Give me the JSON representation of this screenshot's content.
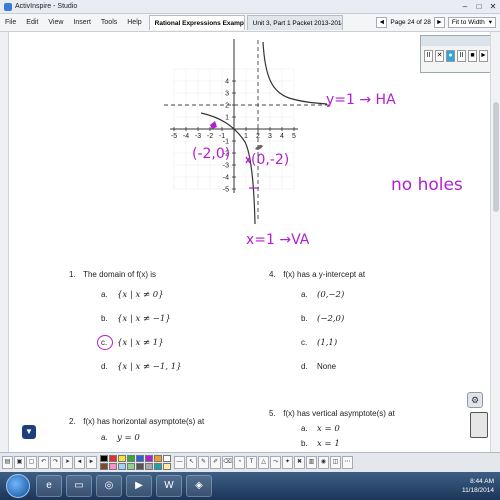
{
  "window": {
    "title": "ActivInspire - Studio",
    "controls": [
      "–",
      "□",
      "✕"
    ]
  },
  "menu": {
    "items": [
      "File",
      "Edit",
      "View",
      "Insert",
      "Tools",
      "Help"
    ]
  },
  "tabs": [
    {
      "label": "Rational Expressions Example",
      "active": true
    },
    {
      "label": "Unit 3, Part 1 Packet 2013-2014*",
      "active": false
    }
  ],
  "page_nav": {
    "page_label": "Page 24 of 28",
    "fit_label": "Fit to Width",
    "prev": "◄",
    "next": "►",
    "dropdown": "▾"
  },
  "graph": {
    "x_ticks": [
      "-5",
      "-4",
      "-3",
      "-2",
      "-1",
      "1",
      "2",
      "3",
      "4",
      "5"
    ],
    "y_ticks": [
      "4",
      "3",
      "2",
      "1",
      "-1",
      "-2",
      "-3",
      "-4",
      "-5"
    ]
  },
  "annotations": {
    "ha": "y=1 → HA",
    "va": "x=1 →VA",
    "point_left": "(-2,0)",
    "point_right": "(0,-2)",
    "no_holes": "no holes"
  },
  "questions": [
    {
      "num": "1.",
      "text": "The domain of f(x) is",
      "options": [
        {
          "letter": "a.",
          "text": "{x | x ≠ 0}"
        },
        {
          "letter": "b.",
          "text": "{x | x ≠ −1}"
        },
        {
          "letter": "c.",
          "text": "{x | x ≠ 1}",
          "circled": true
        },
        {
          "letter": "d.",
          "text": "{x | x ≠ −1, 1}"
        }
      ]
    },
    {
      "num": "4.",
      "text": "f(x) has a y-intercept at",
      "options": [
        {
          "letter": "a.",
          "text": "(0,−2)"
        },
        {
          "letter": "b.",
          "text": "(−2,0)"
        },
        {
          "letter": "c.",
          "text": "(1,1)"
        },
        {
          "letter": "d.",
          "text": "None"
        }
      ]
    },
    {
      "num": "2.",
      "text": "f(x) has horizontal asymptote(s) at",
      "options": [
        {
          "letter": "a.",
          "text": "y = 0"
        }
      ]
    },
    {
      "num": "5.",
      "text": "f(x) has vertical asymptote(s) at",
      "options": [
        {
          "letter": "a.",
          "text": "x = 0"
        },
        {
          "letter": "b.",
          "text": "x = 1"
        }
      ]
    }
  ],
  "recorder": {
    "buttons": [
      "II",
      "✕",
      "●",
      "II",
      "■",
      "►"
    ]
  },
  "clock": {
    "time": "8:44 AM",
    "date": "11/18/2014"
  },
  "colors": {
    "ink": "#b21fd1",
    "accent": "#2aa7e0"
  }
}
